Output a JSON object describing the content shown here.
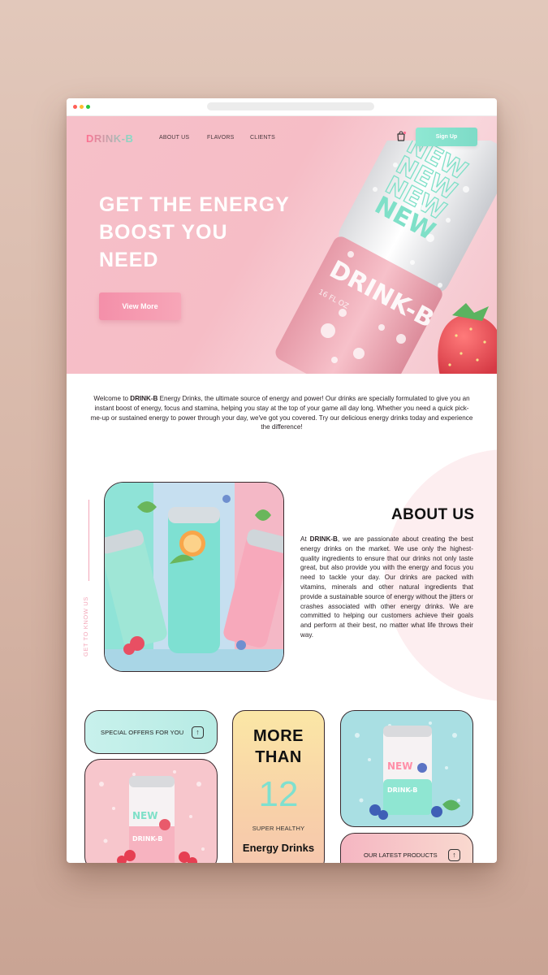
{
  "brand": {
    "logo": "DRINK-B"
  },
  "nav": {
    "items": [
      "ABOUT US",
      "FLAVORS",
      "CLIENTS"
    ],
    "cart_icon": "cart-icon",
    "signup_label": "Sign Up"
  },
  "hero": {
    "title_lines": [
      "GET THE ENERGY",
      "BOOST YOU",
      "NEED"
    ],
    "cta_label": "View More",
    "can_text_new": "NEW",
    "can_text_brand": "DRINK-B",
    "can_text_small": "16 FL OZ"
  },
  "intro": {
    "prefix": "Welcome to ",
    "brand": "DRINK-B",
    "rest": " Energy Drinks, the ultimate source of energy and power! Our drinks are specially formulated to give you an instant boost of energy, focus and stamina, helping you stay at the top of your game all day long. Whether you need a quick pick-me-up or sustained energy to power through your day, we've got you covered. Try our delicious energy drinks today and experience the difference!"
  },
  "about": {
    "side_label": "GET TO KNOW US",
    "title": "ABOUT US",
    "body_prefix": "At ",
    "body_brand": "DRINK-B",
    "body_rest": ", we are passionate about creating the best energy drinks on the market. We use only the highest-quality ingredients to ensure that our drinks not only taste great, but also provide you with the energy and focus you need to tackle your day. Our drinks are packed with vitamins, minerals and other natural ingredients that provide a sustainable source of energy without the jitters or crashes associated with other energy drinks. We are committed to helping our customers achieve their goals and perform at their best, no matter what life throws their way."
  },
  "cards": {
    "offers_label": "SPECIAL OFFERS FOR YOU",
    "more_line1": "MORE",
    "more_line2": "THAN",
    "more_number": "12",
    "more_sub": "SUPER HEALTHY",
    "more_bottom": "Energy Drinks",
    "latest_label": "OUR LATEST PRODUCTS",
    "can_new": "NEW",
    "can_brand": "DRINK-B"
  },
  "colors": {
    "brand_pink": "#f6bdc6",
    "brand_mint": "#7fe0c8",
    "cta_pink": "#f48fa9"
  }
}
